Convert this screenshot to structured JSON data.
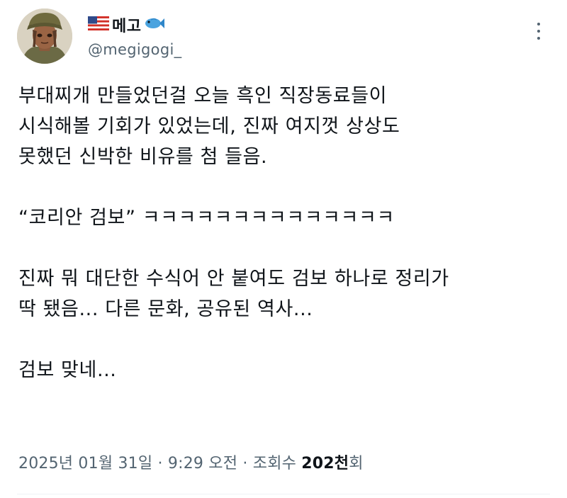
{
  "author": {
    "display_name": "메고",
    "handle": "@megigogi_",
    "flag_icon": "us-flag-icon",
    "fish_icon": "fish-icon"
  },
  "tweet": {
    "lines": [
      "부대찌개 만들었던걸 오늘 흑인 직장동료들이",
      "시식해볼 기회가 있었는데, 진짜 여지껏 상상도",
      "못했던 신박한 비유를 첨 들음.",
      "",
      "“코리안 검보” ㅋㅋㅋㅋㅋㅋㅋㅋㅋㅋㅋㅋㅋㅋ",
      "",
      "진짜 뭐 대단한 수식어 안 붙여도 검보 하나로 정리가",
      "딱 됐음... 다른 문화, 공유된 역사...",
      "",
      "검보 맞네..."
    ]
  },
  "meta": {
    "date": "2025년 01월 31일",
    "sep1": " · ",
    "time": "9:29 오전",
    "sep2": " · ",
    "views_label": "조회수 ",
    "views_count": "202천",
    "views_suffix": "회"
  },
  "colors": {
    "text": "#0f1419",
    "secondary": "#536471",
    "divider": "#eff3f4"
  }
}
